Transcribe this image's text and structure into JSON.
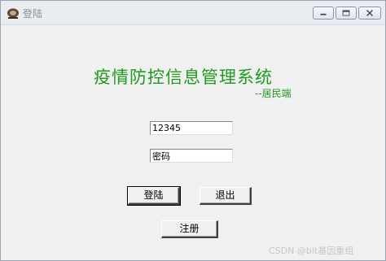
{
  "window": {
    "title": "登陆",
    "controls": {
      "minimize_icon": "minimize-icon",
      "maximize_icon": "maximize-icon",
      "close_icon": "close-icon"
    }
  },
  "main": {
    "heading": "疫情防控信息管理系统",
    "subheading": "--居民端",
    "username": {
      "value": "12345"
    },
    "password": {
      "value": "密码"
    },
    "buttons": {
      "login": "登陆",
      "quit": "退出",
      "register": "注册"
    }
  },
  "watermark": "CSDN @bit基因重组",
  "colors": {
    "heading": "#1f9a1f",
    "window_bg": "#f0f0f0",
    "titlebar_bg": "#e9edf2"
  }
}
